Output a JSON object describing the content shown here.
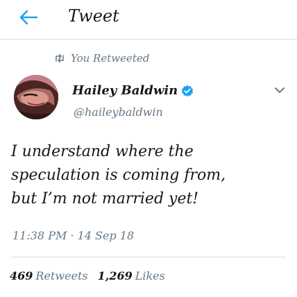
{
  "header": {
    "title": "Tweet",
    "back_icon": "arrow-left-icon"
  },
  "retweet_context": {
    "icon": "retweet-icon",
    "text": "You Retweeted"
  },
  "author": {
    "name": "Hailey Baldwin",
    "handle": "@haileybaldwin",
    "verified": true,
    "verified_icon": "verified-badge-icon",
    "menu_icon": "chevron-down-icon"
  },
  "tweet": {
    "lines": [
      "I understand where the",
      "speculation is coming from,",
      "but I’m not married yet!"
    ],
    "timestamp": "11:38 PM · 14 Sep 18"
  },
  "stats": {
    "retweets_count": "469",
    "retweets_label": "Retweets",
    "likes_count": "1,269",
    "likes_label": "Likes"
  },
  "colors": {
    "accent": "#1da1f2",
    "secondary_text": "#657786",
    "divider": "#d8dde2"
  }
}
